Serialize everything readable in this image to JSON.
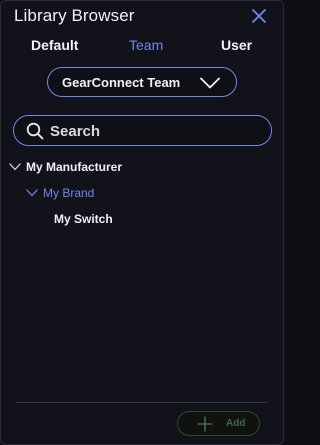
{
  "window": {
    "title": "Library Browser"
  },
  "tabs": [
    {
      "label": "Default",
      "active": false
    },
    {
      "label": "Team",
      "active": true
    },
    {
      "label": "User",
      "active": false
    }
  ],
  "library_select": {
    "value": "GearConnect Team"
  },
  "search": {
    "placeholder": "Search",
    "value": ""
  },
  "tree": [
    {
      "label": "My Manufacturer",
      "expanded": true,
      "level": 0
    },
    {
      "label": "My Brand",
      "expanded": true,
      "level": 1,
      "highlighted": true
    },
    {
      "label": "My Switch",
      "level": 2
    }
  ],
  "footer": {
    "add_label": "Add"
  },
  "colors": {
    "accent": "#6f86ef",
    "background": "#12131a",
    "add_disabled": "#3f6a45"
  },
  "icons": [
    "close-icon",
    "chevron-down-icon",
    "search-icon",
    "plus-icon"
  ]
}
